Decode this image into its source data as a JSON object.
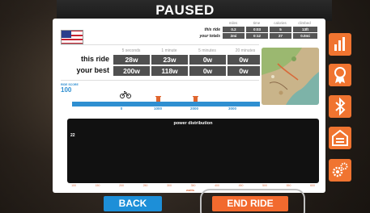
{
  "title": "PAUSED",
  "totals": {
    "headers": [
      "miles",
      "time",
      "calories",
      "climbed"
    ],
    "rows": [
      {
        "label": "this ride",
        "values": [
          "0.2",
          "0:03",
          "5",
          "13ft"
        ]
      },
      {
        "label": "your totals",
        "values": [
          "2mi",
          "0:12",
          "27",
          "0.0mi"
        ]
      }
    ]
  },
  "power": {
    "headers": [
      "5 seconds",
      "1 minute",
      "5 minutes",
      "20 minutes"
    ],
    "rows": [
      {
        "label": "this ride",
        "values": [
          "28w",
          "23w",
          "0w",
          "0w"
        ]
      },
      {
        "label": "your best",
        "values": [
          "200w",
          "118w",
          "0w",
          "0w"
        ]
      }
    ]
  },
  "ride_score": {
    "label": "RIDE SCORE",
    "value": "100",
    "ticks": [
      "0",
      "1000",
      "2000",
      "3000"
    ]
  },
  "distribution": {
    "title": "power distribution",
    "y_label": "22",
    "x_ticks": [
      "100",
      "150",
      "200",
      "250",
      "300",
      "350",
      "400",
      "450",
      "500",
      "550",
      "600"
    ],
    "x_label": "watts"
  },
  "side_icons": [
    "bar-chart-icon",
    "award-ribbon-icon",
    "bluetooth-icon",
    "garage-icon",
    "gears-icon"
  ],
  "buttons": {
    "back": "BACK",
    "end_ride": "END RIDE"
  },
  "colors": {
    "accent": "#f07430",
    "back": "#1d8fd8",
    "score": "#2f8fd1"
  }
}
